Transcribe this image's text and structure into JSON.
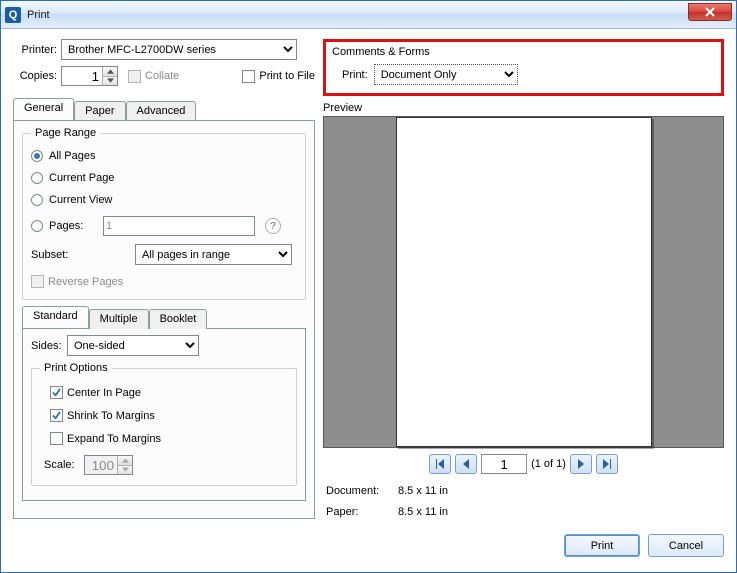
{
  "window": {
    "title": "Print",
    "close_icon": "close"
  },
  "printer": {
    "label": "Printer:",
    "selected": "Brother MFC-L2700DW series",
    "copies_label": "Copies:",
    "copies_value": "1",
    "collate_label": "Collate",
    "collate_checked": false,
    "collate_enabled": false,
    "print_to_file_label": "Print to File",
    "print_to_file_checked": false
  },
  "tabs": {
    "general": "General",
    "paper": "Paper",
    "advanced": "Advanced",
    "active": "general"
  },
  "page_range": {
    "legend": "Page Range",
    "all": "All Pages",
    "current_page": "Current Page",
    "current_view": "Current View",
    "pages_label": "Pages:",
    "pages_value": "1",
    "selected": "all",
    "subset_label": "Subset:",
    "subset_value": "All pages in range",
    "reverse_label": "Reverse Pages",
    "reverse_checked": false,
    "reverse_enabled": false
  },
  "layout_tabs": {
    "standard": "Standard",
    "multiple": "Multiple",
    "booklet": "Booklet",
    "active": "standard"
  },
  "sides": {
    "label": "Sides:",
    "value": "One-sided"
  },
  "print_options": {
    "legend": "Print Options",
    "center": "Center In Page",
    "center_checked": true,
    "shrink": "Shrink To Margins",
    "shrink_checked": true,
    "expand": "Expand To Margins",
    "expand_checked": false,
    "scale_label": "Scale:",
    "scale_value": "100"
  },
  "comments_forms": {
    "legend": "Comments & Forms",
    "print_label": "Print:",
    "value": "Document Only"
  },
  "preview": {
    "label": "Preview",
    "page_input": "1",
    "page_count_text": "(1 of 1)",
    "document_label": "Document:",
    "document_value": "8.5 x 11 in",
    "paper_label": "Paper:",
    "paper_value": "8.5 x 11 in"
  },
  "buttons": {
    "print": "Print",
    "cancel": "Cancel"
  }
}
